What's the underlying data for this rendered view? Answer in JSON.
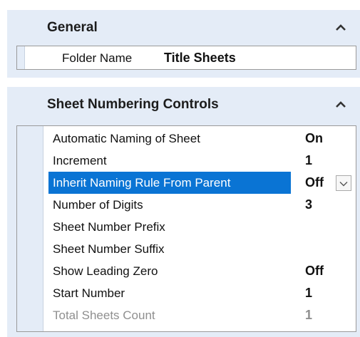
{
  "general": {
    "title": "General",
    "rows": [
      {
        "name": "Folder Name",
        "value": "Title Sheets"
      }
    ]
  },
  "sheet_numbering": {
    "title": "Sheet Numbering Controls",
    "rows": [
      {
        "name": "Automatic Naming of Sheet",
        "value": "On"
      },
      {
        "name": "Increment",
        "value": "1"
      },
      {
        "name": "Inherit Naming Rule From Parent",
        "value": "Off"
      },
      {
        "name": "Number of Digits",
        "value": "3"
      },
      {
        "name": "Sheet Number Prefix",
        "value": ""
      },
      {
        "name": "Sheet Number Suffix",
        "value": ""
      },
      {
        "name": "Show Leading Zero",
        "value": "Off"
      },
      {
        "name": "Start Number",
        "value": "1"
      },
      {
        "name": "Total Sheets Count",
        "value": "1"
      }
    ]
  },
  "icons": {
    "collapse": "chevron-up-icon",
    "dropdown": "chevron-down-icon"
  },
  "colors": {
    "panel_bg": "#e4ecf7",
    "selection": "#0a74d4",
    "disabled_text": "#8f8f8f"
  }
}
